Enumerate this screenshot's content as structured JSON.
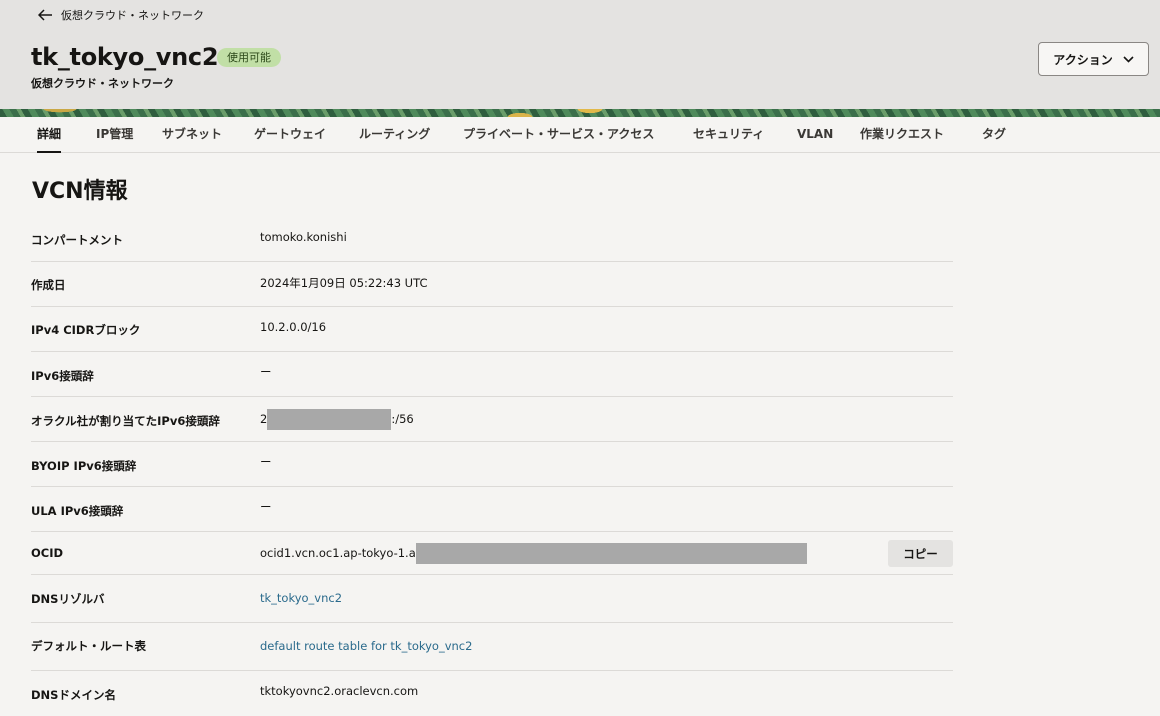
{
  "header": {
    "back_label": "仮想クラウド・ネットワーク",
    "title": "tk_tokyo_vnc2",
    "status": "使用可能",
    "subtitle": "仮想クラウド・ネットワーク",
    "action_label": "アクション"
  },
  "tabs": [
    {
      "label": "詳細",
      "active": true
    },
    {
      "label": "IP管理"
    },
    {
      "label": "サブネット"
    },
    {
      "label": "ゲートウェイ"
    },
    {
      "label": "ルーティング"
    },
    {
      "label": "プライベート・サービス・アクセス"
    },
    {
      "label": "セキュリティ"
    },
    {
      "label": "VLAN"
    },
    {
      "label": "作業リクエスト"
    },
    {
      "label": "タグ"
    }
  ],
  "section": {
    "title": "VCN情報"
  },
  "info": {
    "compartment": {
      "label": "コンパートメント",
      "value": "tomoko.konishi"
    },
    "created": {
      "label": "作成日",
      "value": "2024年1月09日 05:22:43 UTC"
    },
    "ipv4_cidr": {
      "label": "IPv4 CIDRブロック",
      "value": "10.2.0.0/16"
    },
    "ipv6_prefix": {
      "label": "IPv6接頭辞",
      "value": "ー"
    },
    "oracle_ipv6": {
      "label": "オラクル社が割り当てたIPv6接頭辞",
      "value_prefix": "2",
      "value_suffix": ":/56"
    },
    "byoip_ipv6": {
      "label": "BYOIP IPv6接頭辞",
      "value": "ー"
    },
    "ula_ipv6": {
      "label": "ULA IPv6接頭辞",
      "value": "ー"
    },
    "ocid": {
      "label": "OCID",
      "value_prefix": "ocid1.vcn.oc1.ap-tokyo-1.a",
      "copy_label": "コピー"
    },
    "dns_resolver": {
      "label": "DNSリゾルバ",
      "value": "tk_tokyo_vnc2"
    },
    "default_route": {
      "label": "デフォルト・ルート表",
      "value": "default route table for tk_tokyo_vnc2"
    },
    "dns_domain": {
      "label": "DNSドメイン名",
      "value": "tktokyovnc2.oraclevcn.com"
    }
  }
}
